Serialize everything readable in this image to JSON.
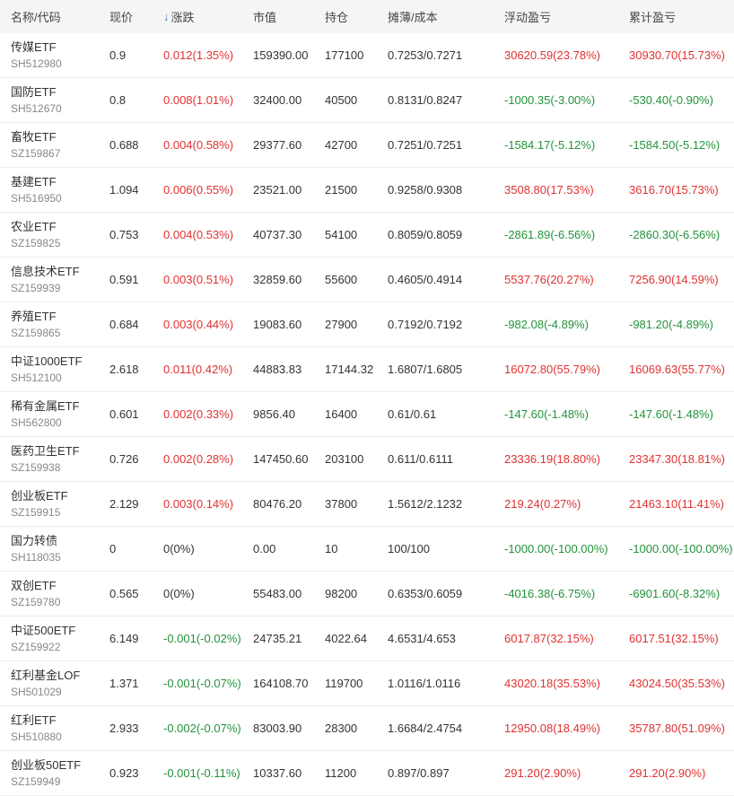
{
  "headers": {
    "name_code": "名称/代码",
    "price": "现价",
    "change": "涨跌",
    "market_value": "市值",
    "holding": "持仓",
    "cost": "摊薄/成本",
    "float_pl": "浮动盈亏",
    "total_pl": "累计盈亏"
  },
  "sort_icon": "arrow-down-icon",
  "colors": {
    "up": "#e03131",
    "down": "#22933b",
    "sort": "#3a7bd5"
  },
  "rows": [
    {
      "name": "传媒ETF",
      "code": "SH512980",
      "price": "0.9",
      "change": "0.012(1.35%)",
      "change_dir": "up",
      "market_value": "159390.00",
      "holding": "177100",
      "cost": "0.7253/0.7271",
      "float_pl": "30620.59(23.78%)",
      "float_dir": "up",
      "total_pl": "30930.70(15.73%)",
      "total_dir": "up"
    },
    {
      "name": "国防ETF",
      "code": "SH512670",
      "price": "0.8",
      "change": "0.008(1.01%)",
      "change_dir": "up",
      "market_value": "32400.00",
      "holding": "40500",
      "cost": "0.8131/0.8247",
      "float_pl": "-1000.35(-3.00%)",
      "float_dir": "down",
      "total_pl": "-530.40(-0.90%)",
      "total_dir": "down"
    },
    {
      "name": "畜牧ETF",
      "code": "SZ159867",
      "price": "0.688",
      "change": "0.004(0.58%)",
      "change_dir": "up",
      "market_value": "29377.60",
      "holding": "42700",
      "cost": "0.7251/0.7251",
      "float_pl": "-1584.17(-5.12%)",
      "float_dir": "down",
      "total_pl": "-1584.50(-5.12%)",
      "total_dir": "down"
    },
    {
      "name": "基建ETF",
      "code": "SH516950",
      "price": "1.094",
      "change": "0.006(0.55%)",
      "change_dir": "up",
      "market_value": "23521.00",
      "holding": "21500",
      "cost": "0.9258/0.9308",
      "float_pl": "3508.80(17.53%)",
      "float_dir": "up",
      "total_pl": "3616.70(15.73%)",
      "total_dir": "up"
    },
    {
      "name": "农业ETF",
      "code": "SZ159825",
      "price": "0.753",
      "change": "0.004(0.53%)",
      "change_dir": "up",
      "market_value": "40737.30",
      "holding": "54100",
      "cost": "0.8059/0.8059",
      "float_pl": "-2861.89(-6.56%)",
      "float_dir": "down",
      "total_pl": "-2860.30(-6.56%)",
      "total_dir": "down"
    },
    {
      "name": "信息技术ETF",
      "code": "SZ159939",
      "price": "0.591",
      "change": "0.003(0.51%)",
      "change_dir": "up",
      "market_value": "32859.60",
      "holding": "55600",
      "cost": "0.4605/0.4914",
      "float_pl": "5537.76(20.27%)",
      "float_dir": "up",
      "total_pl": "7256.90(14.59%)",
      "total_dir": "up"
    },
    {
      "name": "养殖ETF",
      "code": "SZ159865",
      "price": "0.684",
      "change": "0.003(0.44%)",
      "change_dir": "up",
      "market_value": "19083.60",
      "holding": "27900",
      "cost": "0.7192/0.7192",
      "float_pl": "-982.08(-4.89%)",
      "float_dir": "down",
      "total_pl": "-981.20(-4.89%)",
      "total_dir": "down"
    },
    {
      "name": "中证1000ETF",
      "code": "SH512100",
      "price": "2.618",
      "change": "0.011(0.42%)",
      "change_dir": "up",
      "market_value": "44883.83",
      "holding": "17144.32",
      "cost": "1.6807/1.6805",
      "float_pl": "16072.80(55.79%)",
      "float_dir": "up",
      "total_pl": "16069.63(55.77%)",
      "total_dir": "up"
    },
    {
      "name": "稀有金属ETF",
      "code": "SH562800",
      "price": "0.601",
      "change": "0.002(0.33%)",
      "change_dir": "up",
      "market_value": "9856.40",
      "holding": "16400",
      "cost": "0.61/0.61",
      "float_pl": "-147.60(-1.48%)",
      "float_dir": "down",
      "total_pl": "-147.60(-1.48%)",
      "total_dir": "down"
    },
    {
      "name": "医药卫生ETF",
      "code": "SZ159938",
      "price": "0.726",
      "change": "0.002(0.28%)",
      "change_dir": "up",
      "market_value": "147450.60",
      "holding": "203100",
      "cost": "0.611/0.6111",
      "float_pl": "23336.19(18.80%)",
      "float_dir": "up",
      "total_pl": "23347.30(18.81%)",
      "total_dir": "up"
    },
    {
      "name": "创业板ETF",
      "code": "SZ159915",
      "price": "2.129",
      "change": "0.003(0.14%)",
      "change_dir": "up",
      "market_value": "80476.20",
      "holding": "37800",
      "cost": "1.5612/2.1232",
      "float_pl": "219.24(0.27%)",
      "float_dir": "up",
      "total_pl": "21463.10(11.41%)",
      "total_dir": "up"
    },
    {
      "name": "国力转债",
      "code": "SH118035",
      "price": "0",
      "change": "0(0%)",
      "change_dir": "flat",
      "market_value": "0.00",
      "holding": "10",
      "cost": "100/100",
      "float_pl": "-1000.00(-100.00%)",
      "float_dir": "down",
      "total_pl": "-1000.00(-100.00%)",
      "total_dir": "down"
    },
    {
      "name": "双创ETF",
      "code": "SZ159780",
      "price": "0.565",
      "change": "0(0%)",
      "change_dir": "flat",
      "market_value": "55483.00",
      "holding": "98200",
      "cost": "0.6353/0.6059",
      "float_pl": "-4016.38(-6.75%)",
      "float_dir": "down",
      "total_pl": "-6901.60(-8.32%)",
      "total_dir": "down"
    },
    {
      "name": "中证500ETF",
      "code": "SZ159922",
      "price": "6.149",
      "change": "-0.001(-0.02%)",
      "change_dir": "down",
      "market_value": "24735.21",
      "holding": "4022.64",
      "cost": "4.6531/4.653",
      "float_pl": "6017.87(32.15%)",
      "float_dir": "up",
      "total_pl": "6017.51(32.15%)",
      "total_dir": "up"
    },
    {
      "name": "红利基金LOF",
      "code": "SH501029",
      "price": "1.371",
      "change": "-0.001(-0.07%)",
      "change_dir": "down",
      "market_value": "164108.70",
      "holding": "119700",
      "cost": "1.0116/1.0116",
      "float_pl": "43020.18(35.53%)",
      "float_dir": "up",
      "total_pl": "43024.50(35.53%)",
      "total_dir": "up"
    },
    {
      "name": "红利ETF",
      "code": "SH510880",
      "price": "2.933",
      "change": "-0.002(-0.07%)",
      "change_dir": "down",
      "market_value": "83003.90",
      "holding": "28300",
      "cost": "1.6684/2.4754",
      "float_pl": "12950.08(18.49%)",
      "float_dir": "up",
      "total_pl": "35787.80(51.09%)",
      "total_dir": "up"
    },
    {
      "name": "创业板50ETF",
      "code": "SZ159949",
      "price": "0.923",
      "change": "-0.001(-0.11%)",
      "change_dir": "down",
      "market_value": "10337.60",
      "holding": "11200",
      "cost": "0.897/0.897",
      "float_pl": "291.20(2.90%)",
      "float_dir": "up",
      "total_pl": "291.20(2.90%)",
      "total_dir": "up"
    }
  ]
}
